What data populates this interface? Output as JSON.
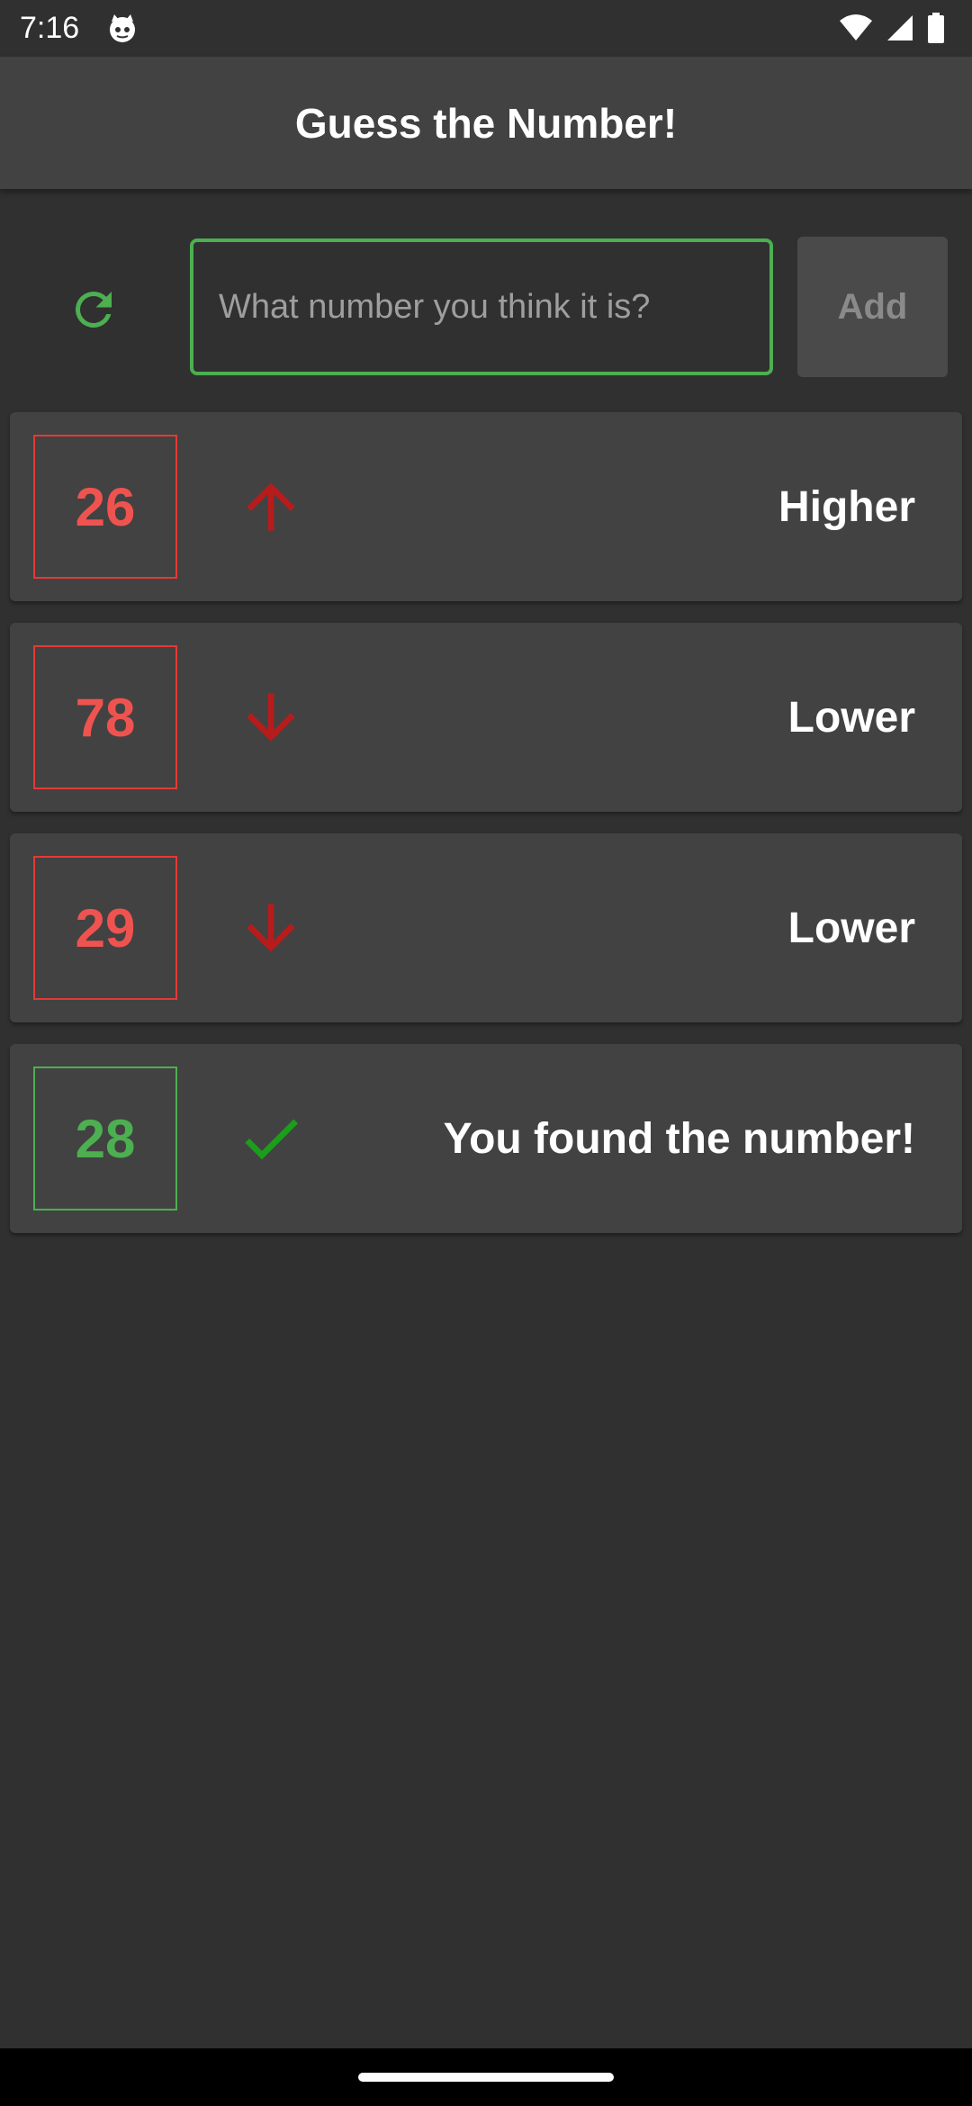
{
  "status_bar": {
    "time": "7:16"
  },
  "app_bar": {
    "title": "Guess the Number!"
  },
  "input_row": {
    "placeholder": "What number you think it is?",
    "value": "",
    "add_label": "Add"
  },
  "guesses": [
    {
      "number": "26",
      "result": "Higher",
      "icon": "arrow-up-icon"
    },
    {
      "number": "78",
      "result": "Lower",
      "icon": "arrow-down-icon"
    },
    {
      "number": "29",
      "result": "Lower",
      "icon": "arrow-down-icon"
    },
    {
      "number": "28",
      "result": "You found the number!",
      "icon": "check-icon"
    }
  ],
  "colors": {
    "accent_green": "#4caf50",
    "wrong_red": "#e53935",
    "arrow_red": "#b71c1c",
    "check_green": "#1b9e1b",
    "background": "#303030",
    "card": "#424242"
  }
}
